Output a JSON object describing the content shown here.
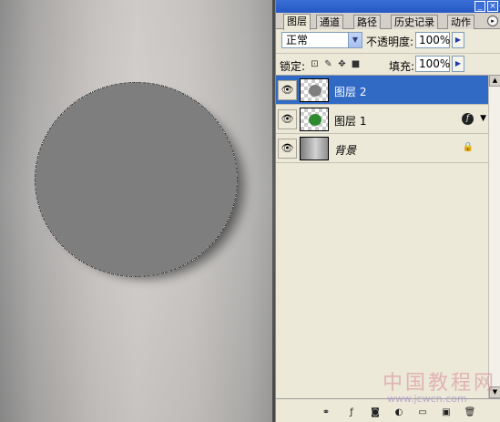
{
  "tabs": [
    "图层",
    "通道",
    "路径",
    "历史记录",
    "动作"
  ],
  "window_buttons": {
    "minimize": "_",
    "close": "×"
  },
  "tab_menu": "▸",
  "blend_mode": "正常",
  "opacity_label": "不透明度:",
  "opacity_value": "100%",
  "lock_label": "锁定:",
  "fill_label": "填充:",
  "fill_value": "100%",
  "flyout_arrow": "▶",
  "dropdown_arrow": "▼",
  "eye_glyph": "👁",
  "layers": [
    {
      "name": "图层 2",
      "selected": true,
      "thumb": "gray-circle",
      "effects": false,
      "locked": false
    },
    {
      "name": "图层 1",
      "selected": false,
      "thumb": "green-circle",
      "effects": true,
      "locked": false
    },
    {
      "name": "背景",
      "selected": false,
      "thumb": "gradient",
      "effects": false,
      "locked": true
    }
  ],
  "fx_glyph": "f",
  "fx_arrow": "▼",
  "lock_glyph": "🔒",
  "watermark": {
    "text": "中国教程网",
    "url": "www.jcwcn.com"
  },
  "colors": {
    "selection": "#316ac5",
    "panel": "#ece9d8",
    "titlebar": "#2457c4",
    "circle": "#7e7e7e"
  }
}
